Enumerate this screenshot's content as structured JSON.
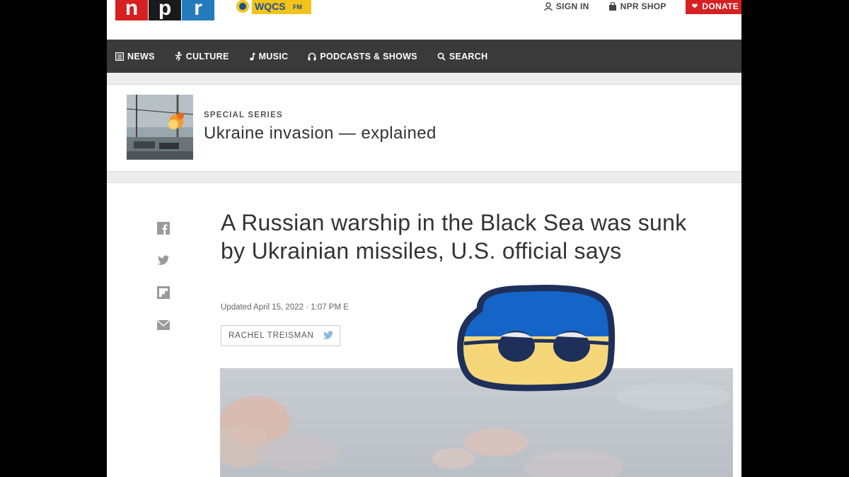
{
  "header": {
    "logo_letters": [
      "n",
      "p",
      "r"
    ],
    "logo_colors": [
      "#d62021",
      "#1a1a1a",
      "#237bbd"
    ],
    "station_name": "WQCS",
    "station_suffix": "FM",
    "sign_in": "SIGN IN",
    "shop": "NPR SHOP",
    "donate": "DONATE"
  },
  "nav": {
    "items": [
      {
        "label": "NEWS",
        "icon": "news-icon"
      },
      {
        "label": "CULTURE",
        "icon": "culture-icon"
      },
      {
        "label": "MUSIC",
        "icon": "music-icon"
      },
      {
        "label": "PODCASTS & SHOWS",
        "icon": "headphones-icon"
      },
      {
        "label": "SEARCH",
        "icon": "search-icon"
      }
    ]
  },
  "series": {
    "kicker": "SPECIAL SERIES",
    "title": "Ukraine invasion — explained"
  },
  "article": {
    "headline": "A Russian warship in the Black Sea was sunk by Ukrainian missiles, U.S. official says",
    "dateline": "Updated April 15, 2022 · 1:07 PM E",
    "author": "RACHEL TREISMAN",
    "share_icons": [
      "facebook-icon",
      "twitter-icon",
      "flipboard-icon",
      "email-icon"
    ]
  },
  "colors": {
    "accent_red": "#d62021",
    "nav_bg": "#3a3a3a",
    "sticker_blue": "#1565c8",
    "sticker_yellow": "#f5d77a",
    "sticker_outline": "#1e2f5a"
  }
}
